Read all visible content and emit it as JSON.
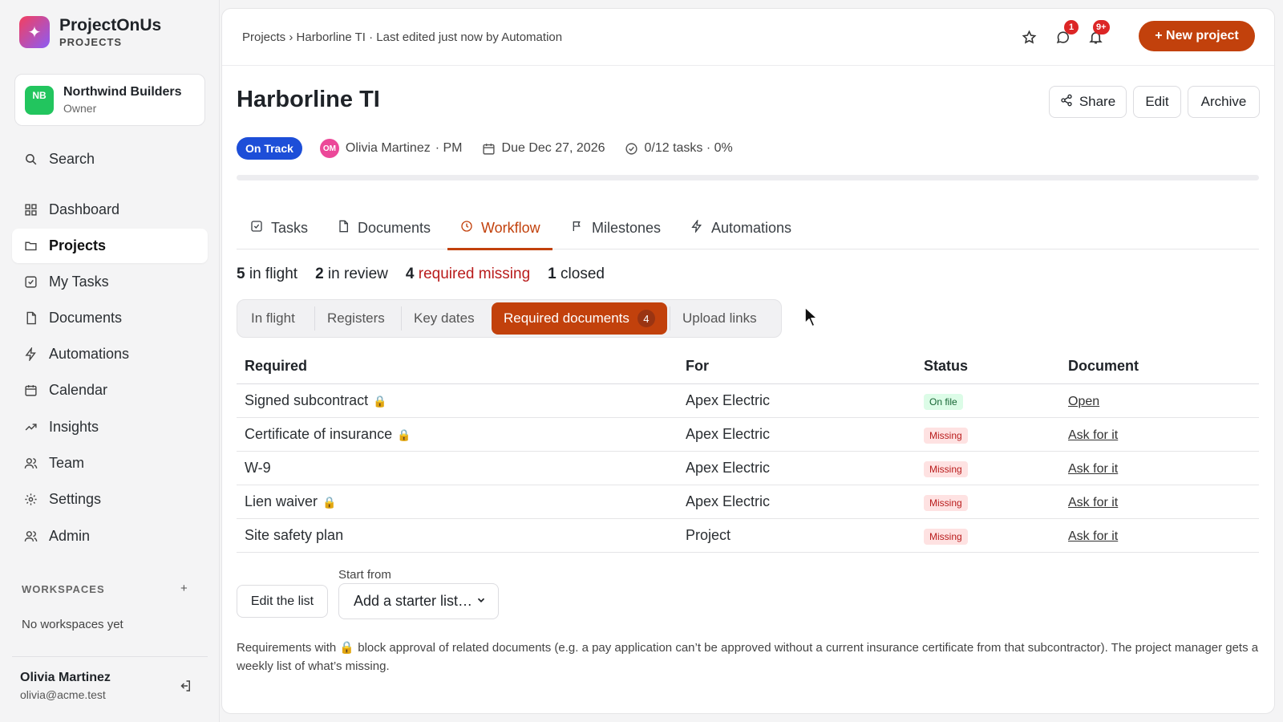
{
  "app": {
    "name": "ProjectOnUs",
    "sub": "PROJECTS",
    "logo_glyph": "✦"
  },
  "org": {
    "initials": "NB",
    "name": "Northwind Builders",
    "role": "Owner"
  },
  "nav": [
    {
      "label": "Search",
      "icon": "search-icon"
    },
    {
      "label": "Dashboard",
      "icon": "dashboard-icon"
    },
    {
      "label": "Projects",
      "icon": "folder-icon",
      "active": true
    },
    {
      "label": "My Tasks",
      "icon": "checkbox-icon"
    },
    {
      "label": "Documents",
      "icon": "document-icon"
    },
    {
      "label": "Automations",
      "icon": "bolt-icon"
    },
    {
      "label": "Calendar",
      "icon": "calendar-icon"
    },
    {
      "label": "Insights",
      "icon": "trend-icon"
    },
    {
      "label": "Team",
      "icon": "team-icon"
    },
    {
      "label": "Settings",
      "icon": "gear-icon"
    },
    {
      "label": "Admin",
      "icon": "admin-icon"
    }
  ],
  "workspaces": {
    "label": "WORKSPACES",
    "add": "+",
    "empty": "No workspaces yet"
  },
  "user": {
    "name": "Olivia Martinez",
    "email": "olivia@acme.test"
  },
  "topbar": {
    "breadcrumb": "Projects › Harborline TI · Last edited just now by Automation",
    "messages_badge": "1",
    "notifications_badge": "9+",
    "new_project": "+ New project"
  },
  "project": {
    "title": "Harborline TI",
    "share": "Share",
    "edit": "Edit",
    "archive": "Archive",
    "status": "On Track",
    "pm_initials": "OM",
    "pm": "Olivia Martinez",
    "pm_role": "· PM",
    "due": "Due Dec 27, 2026",
    "tasks": "0/12 tasks · 0%",
    "progress": 0
  },
  "tabs": [
    {
      "label": "Tasks",
      "icon": "checkbox-icon"
    },
    {
      "label": "Documents",
      "icon": "document-icon"
    },
    {
      "label": "Workflow",
      "icon": "clock-icon",
      "active": true
    },
    {
      "label": "Milestones",
      "icon": "flag-icon"
    },
    {
      "label": "Automations",
      "icon": "bolt-icon"
    }
  ],
  "summary": {
    "in_flight_n": "5",
    "in_flight": "in flight",
    "in_review_n": "2",
    "in_review": "in review",
    "missing_n": "4",
    "missing": "required missing",
    "closed_n": "1",
    "closed": "closed"
  },
  "segments": [
    {
      "label": "In flight"
    },
    {
      "label": "Registers"
    },
    {
      "label": "Key dates"
    },
    {
      "label": "Required documents",
      "count": "4",
      "active": true
    },
    {
      "label": "Upload links"
    }
  ],
  "table": {
    "headers": [
      "Required",
      "For",
      "Status",
      "Document"
    ],
    "rows": [
      {
        "required": "Signed subcontract",
        "locked": true,
        "for": "Apex Electric",
        "status": "On file",
        "status_kind": "ok",
        "doc": "Open"
      },
      {
        "required": "Certificate of insurance",
        "locked": true,
        "for": "Apex Electric",
        "status": "Missing",
        "status_kind": "missing",
        "doc": "Ask for it"
      },
      {
        "required": "W-9",
        "locked": false,
        "for": "Apex Electric",
        "status": "Missing",
        "status_kind": "missing",
        "doc": "Ask for it"
      },
      {
        "required": "Lien waiver",
        "locked": true,
        "for": "Apex Electric",
        "status": "Missing",
        "status_kind": "missing",
        "doc": "Ask for it"
      },
      {
        "required": "Site safety plan",
        "locked": false,
        "for": "Project",
        "status": "Missing",
        "status_kind": "missing",
        "doc": "Ask for it"
      }
    ]
  },
  "list_controls": {
    "start_from": "Start from",
    "edit": "Edit the list",
    "starter": "Add a starter list…"
  },
  "footnote": {
    "before": "Requirements with",
    "lock": "🔒",
    "after": "block approval of related documents (e.g. a pay application can’t be approved without a current insurance certificate from that subcontractor). The project manager gets a weekly list of what’s missing."
  },
  "colors": {
    "accent": "#c2410c",
    "status_on_track": "#1d4ed8",
    "missing": "#b91c1c",
    "on_file": "#166534"
  }
}
